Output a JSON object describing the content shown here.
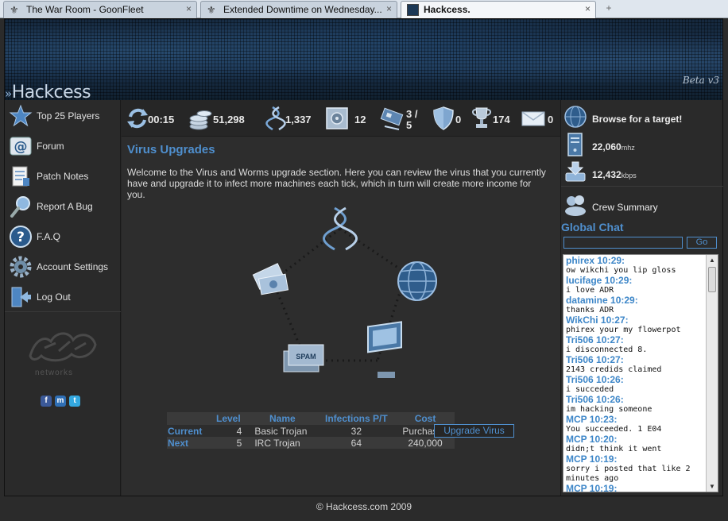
{
  "browser": {
    "tabs": [
      {
        "label": "The War Room - GoonFleet",
        "icon": "flag-icon",
        "close": "×"
      },
      {
        "label": "Extended Downtime on Wednesday...",
        "icon": "flag-icon",
        "close": "×"
      },
      {
        "label": "Hackcess.",
        "icon": "page-icon",
        "close": "×"
      }
    ],
    "new_tab": "+"
  },
  "header": {
    "logo_arrows": "»",
    "logo": "Hackcess",
    "version": "Beta v3"
  },
  "sidebar": {
    "items": [
      {
        "label": "Top 25 Players",
        "icon": "star-icon"
      },
      {
        "label": "Forum",
        "icon": "at-icon"
      },
      {
        "label": "Patch Notes",
        "icon": "notes-icon"
      },
      {
        "label": "Report A Bug",
        "icon": "magnifier-icon"
      },
      {
        "label": "F.A.Q",
        "icon": "help-icon"
      },
      {
        "label": "Account Settings",
        "icon": "gear-icon"
      },
      {
        "label": "Log Out",
        "icon": "logout-icon"
      }
    ],
    "brand_text": "networks",
    "social": [
      "f",
      "m",
      "t"
    ]
  },
  "stats": {
    "timer": "00:15",
    "money": "51,298",
    "dna": "1,337",
    "vault": "12",
    "slots": "3 /",
    "slots_max": "5",
    "shield": "0",
    "trophy": "174",
    "mail": "0"
  },
  "main": {
    "title": "Virus Upgrades",
    "description": "Welcome to the Virus and Worms upgrade section. Here you can review the virus that you currently have and upgrade it to infect more machines each tick, which in turn will create more income for you.",
    "spam_label": "SPAM",
    "table": {
      "headers": [
        "Level",
        "Name",
        "Infections P/T",
        "Cost"
      ],
      "rows": [
        {
          "label": "Current",
          "level": "4",
          "name": "Basic Trojan",
          "infections": "32",
          "cost": "Purchased"
        },
        {
          "label": "Next",
          "level": "5",
          "name": "IRC Trojan",
          "infections": "64",
          "cost": "240,000"
        }
      ]
    },
    "upgrade_button": "Upgrade Virus"
  },
  "right": {
    "browse": "Browse for a target!",
    "cpu_value": "22,060",
    "cpu_unit": "mhz",
    "bandwidth_value": "12,432",
    "bandwidth_unit": "kbps",
    "crew": "Crew Summary",
    "chat_title": "Global Chat",
    "chat_input": "",
    "chat_go": "Go",
    "messages": [
      {
        "who": "phirex 10:29:",
        "text": "ow wikchi you lip gloss"
      },
      {
        "who": "lucifage 10:29:",
        "text": "i love ADR"
      },
      {
        "who": "datamine 10:29:",
        "text": "thanks ADR"
      },
      {
        "who": "WikChi 10:27:",
        "text": "phirex your my flowerpot"
      },
      {
        "who": "Tri506 10:27:",
        "text": "i disconnected 8."
      },
      {
        "who": "Tri506 10:27:",
        "text": "2143 credids claimed"
      },
      {
        "who": "Tri506 10:26:",
        "text": "i succeded"
      },
      {
        "who": "Tri506 10:26:",
        "text": "im hacking someone"
      },
      {
        "who": "MCP 10:23:",
        "text": "You succeeded. 1 E04"
      },
      {
        "who": "MCP 10:20:",
        "text": "didn;t think it went"
      },
      {
        "who": "MCP 10:19:",
        "text": "sorry i posted that like 2 minutes ago"
      },
      {
        "who": "MCP 10:19:",
        "text": ""
      }
    ],
    "scroll_up": "▲",
    "scroll_down": "▼"
  },
  "footer": {
    "copyright": "© Hackcess.com 2009"
  },
  "colors": {
    "accent": "#4f8fce",
    "background": "#262626",
    "text": "#e2e2e2"
  }
}
